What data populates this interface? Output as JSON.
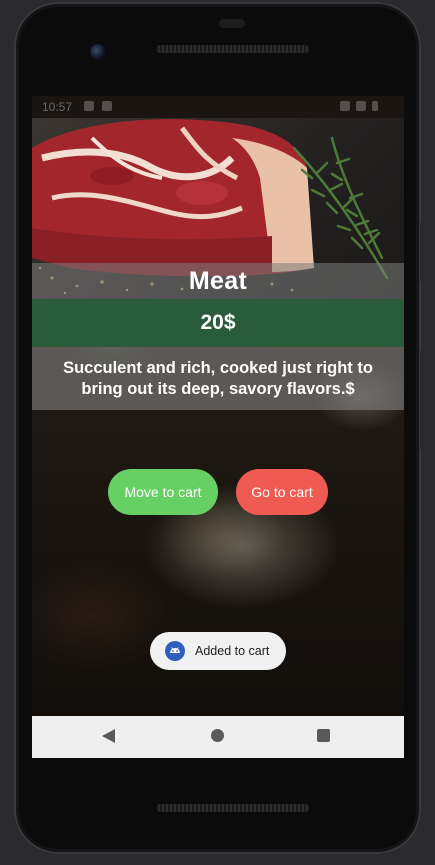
{
  "status_bar": {
    "time": "10:57"
  },
  "product": {
    "title": "Meat",
    "price": "20$",
    "description": "Succulent and rich, cooked just right to bring out its deep, savory flavors.$"
  },
  "actions": {
    "move_to_cart": "Move to cart",
    "go_to_cart": "Go to cart"
  },
  "toast": {
    "message": "Added to cart",
    "icon": "android-icon"
  },
  "navigation": {
    "back": "back-icon",
    "home": "home-icon",
    "recents": "recents-icon"
  },
  "colors": {
    "price_band": "#2a5c3c",
    "move_button": "#67d065",
    "go_button": "#ef5b52",
    "toast_bg": "#f1f1f1"
  }
}
